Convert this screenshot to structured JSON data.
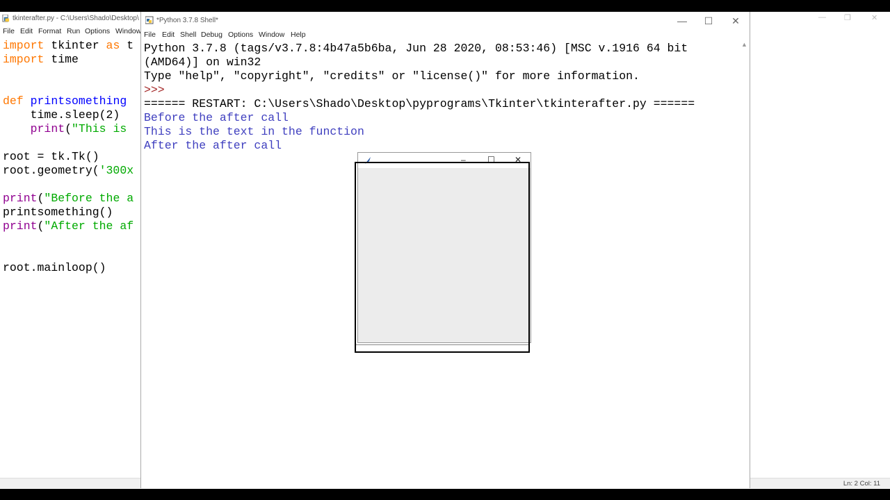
{
  "editor": {
    "title": "tkinterafter.py - C:\\Users\\Shado\\Desktop\\",
    "menu": [
      "File",
      "Edit",
      "Format",
      "Run",
      "Options",
      "Window"
    ],
    "code_lines": [
      [
        {
          "t": "import",
          "c": "kw"
        },
        {
          "t": " tkinter ",
          "c": ""
        },
        {
          "t": "as",
          "c": "kw"
        },
        {
          "t": " t",
          "c": ""
        }
      ],
      [
        {
          "t": "import",
          "c": "kw"
        },
        {
          "t": " time",
          "c": ""
        }
      ],
      [],
      [],
      [
        {
          "t": "def",
          "c": "kw"
        },
        {
          "t": " printsomething",
          "c": "fn"
        }
      ],
      [
        {
          "t": "    time.sleep(2)",
          "c": ""
        }
      ],
      [
        {
          "t": "    ",
          "c": ""
        },
        {
          "t": "print",
          "c": "bi"
        },
        {
          "t": "(",
          "c": ""
        },
        {
          "t": "\"This is",
          "c": "str"
        }
      ],
      [],
      [
        {
          "t": "root = tk.Tk()",
          "c": ""
        }
      ],
      [
        {
          "t": "root.geometry(",
          "c": ""
        },
        {
          "t": "'300x",
          "c": "str"
        }
      ],
      [],
      [
        {
          "t": "print",
          "c": "bi"
        },
        {
          "t": "(",
          "c": ""
        },
        {
          "t": "\"Before the a",
          "c": "str"
        }
      ],
      [
        {
          "t": "printsomething()",
          "c": ""
        }
      ],
      [
        {
          "t": "print",
          "c": "bi"
        },
        {
          "t": "(",
          "c": ""
        },
        {
          "t": "\"After the af",
          "c": "str"
        }
      ],
      [],
      [],
      [
        {
          "t": "root.mainloop()",
          "c": ""
        }
      ]
    ],
    "status": "Ln: 2   Col: 11"
  },
  "shell": {
    "title": "*Python 3.7.8 Shell*",
    "menu": [
      "File",
      "Edit",
      "Shell",
      "Debug",
      "Options",
      "Window",
      "Help"
    ],
    "controls": {
      "minimize": "—",
      "maximize": "☐",
      "close": "✕"
    },
    "lines": [
      {
        "t": "Python 3.7.8 (tags/v3.7.8:4b47a5b6ba, Jun 28 2020, 08:53:46) [MSC v.1916 64 bit",
        "c": "ver"
      },
      {
        "t": "(AMD64)] on win32",
        "c": "ver"
      },
      {
        "t": "Type \"help\", \"copyright\", \"credits\" or \"license()\" for more information.",
        "c": "ver"
      },
      {
        "t": ">>> ",
        "c": "prompt"
      },
      {
        "t": "====== RESTART: C:\\Users\\Shado\\Desktop\\pyprograms\\Tkinter\\tkinterafter.py ======",
        "c": "restart"
      },
      {
        "t": "Before the after call",
        "c": "stdout"
      },
      {
        "t": "This is the text in the function",
        "c": "stdout"
      },
      {
        "t": "After the after call",
        "c": "stdout"
      }
    ]
  },
  "tk_window": {
    "controls": {
      "minimize": "–",
      "maximize": "☐",
      "close": "✕"
    }
  }
}
